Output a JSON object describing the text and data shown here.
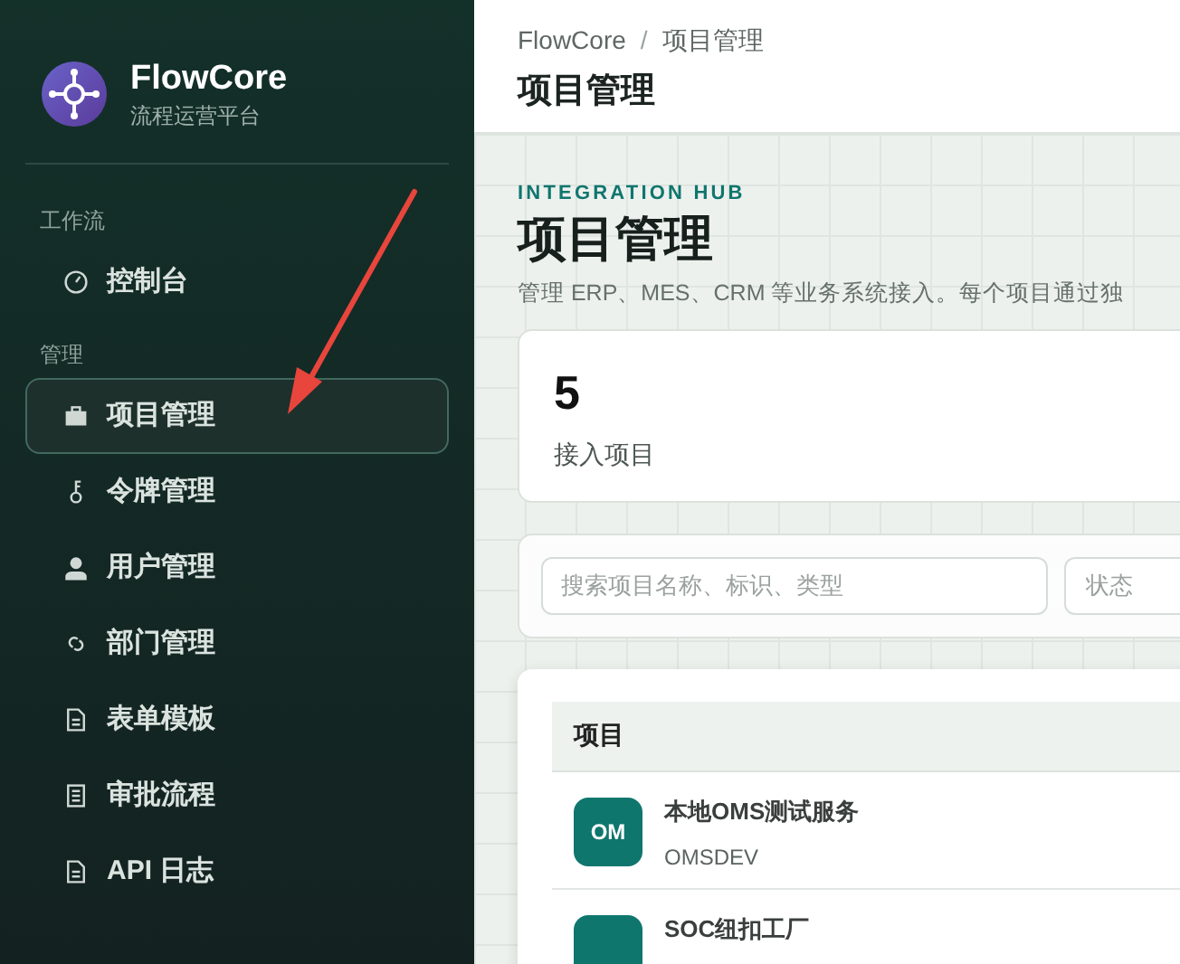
{
  "brand": {
    "name": "FlowCore",
    "subtitle": "流程运营平台"
  },
  "sidebar": {
    "sections": [
      {
        "title": "工作流",
        "items": [
          {
            "label": "控制台",
            "kind": "gauge",
            "selected": false
          }
        ]
      },
      {
        "title": "管理",
        "items": [
          {
            "label": "项目管理",
            "kind": "briefcase",
            "selected": true
          },
          {
            "label": "令牌管理",
            "kind": "key",
            "selected": false
          },
          {
            "label": "用户管理",
            "kind": "user",
            "selected": false
          },
          {
            "label": "部门管理",
            "kind": "link",
            "selected": false
          },
          {
            "label": "表单模板",
            "kind": "file",
            "selected": false
          },
          {
            "label": "审批流程",
            "kind": "list",
            "selected": false
          },
          {
            "label": "API 日志",
            "kind": "file",
            "selected": false
          }
        ]
      }
    ]
  },
  "breadcrumb": {
    "items": [
      "FlowCore",
      "项目管理"
    ],
    "separator": "/"
  },
  "header_title": "项目管理",
  "eyebrow": "INTEGRATION HUB",
  "page_title": "项目管理",
  "description": "管理 ERP、MES、CRM 等业务系统接入。每个项目通过独",
  "stat": {
    "value": "5",
    "label": "接入项目"
  },
  "filters": {
    "search_placeholder": "搜索项目名称、标识、类型",
    "status_placeholder": "状态"
  },
  "table": {
    "columns": [
      "项目"
    ],
    "rows": [
      {
        "avatar": "OM",
        "name": "本地OMS测试服务",
        "code": "OMSDEV"
      },
      {
        "name": "SOC纽扣工厂"
      }
    ]
  }
}
